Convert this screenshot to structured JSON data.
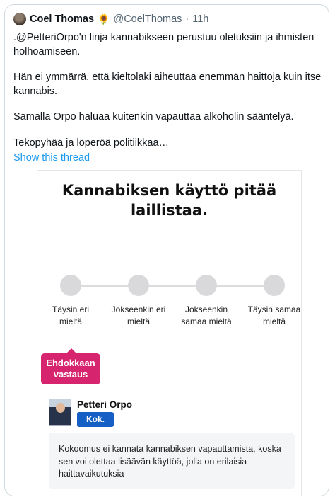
{
  "tweet": {
    "author_name": "Coel Thomas",
    "author_emoji": "🌻",
    "handle": "@CoelThomas",
    "separator": "·",
    "time": "11h",
    "paragraphs": [
      ".@PetteriOrpo'n linja kannabikseen perustuu oletuksiin ja ihmisten holhoamiseen.",
      "Hän ei ymmärrä, että kieltolaki aiheuttaa enemmän haittoja kuin itse kannabis.",
      "Samalla Orpo haluaa kuitenkin vapauttaa alkoholin sääntelyä.",
      "Tekopyhää ja löperöä politiikkaa…"
    ],
    "show_thread": "Show this thread",
    "link_color": "#1d9bf0"
  },
  "card": {
    "title": "Kannabiksen käyttö pitää laillistaa.",
    "scale": [
      {
        "label": "Täysin eri mieltä"
      },
      {
        "label": "Jokseenkin eri mieltä"
      },
      {
        "label": "Jokseenkin samaa mieltä"
      },
      {
        "label": "Täysin samaa mieltä"
      }
    ],
    "badge": "Ehdokkaan vastaus",
    "badge_color": "#d6246e",
    "candidate": {
      "name": "Petteri Orpo",
      "party": "Kok.",
      "party_color": "#1660c5"
    },
    "answer": "Kokoomus ei kannata kannabiksen vapauttamista, koska sen voi olettaa lisäävän käyttöä, jolla on erilaisia haittavaikutuksia"
  }
}
